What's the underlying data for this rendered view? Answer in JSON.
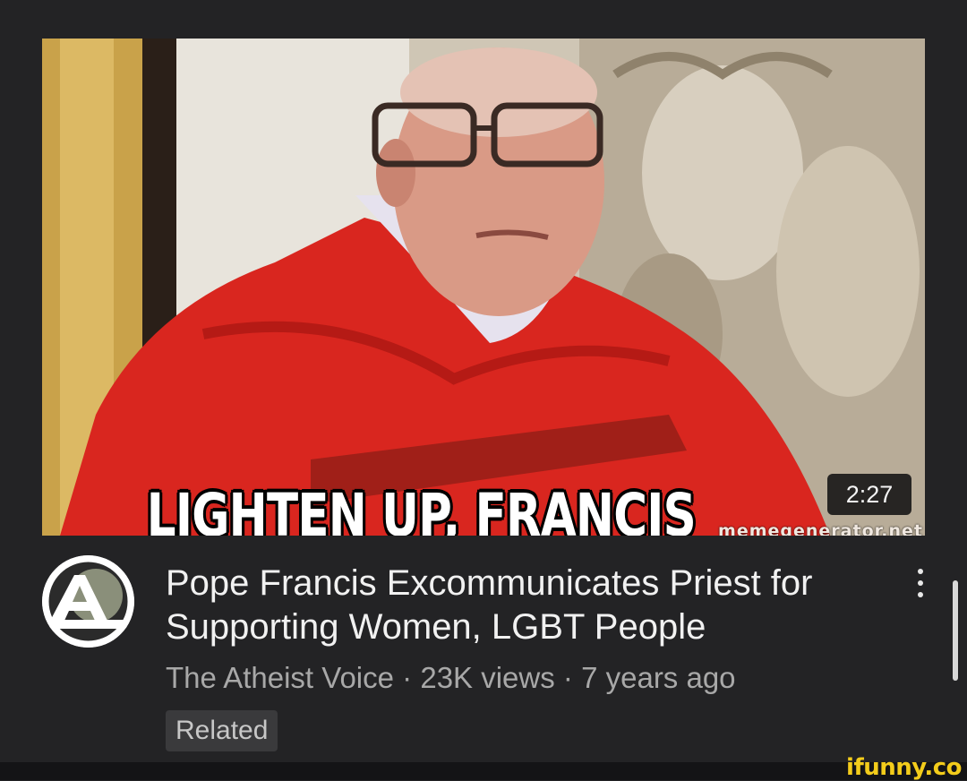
{
  "video": {
    "thumbnail_caption": "LIGHTEN UP, FRANCIS",
    "thumbnail_watermark": "memegenerator.net",
    "duration": "2:27",
    "title": "Pope Francis Excommunicates Priest for Supporting Women, LGBT People",
    "channel": "The Atheist Voice",
    "views": "23K views",
    "age": "7 years ago",
    "separator": "·",
    "badge": "Related"
  },
  "avatar_letter": "A",
  "site_watermark": "ifunny.co",
  "colors": {
    "background": "#232325",
    "title_text": "#f1f1f1",
    "meta_text": "#a8a8a8",
    "badge_bg": "#3a3a3c",
    "robe_red": "#d9261f",
    "ifunny_yellow": "#f3cc1b"
  },
  "icons": {
    "menu": "more-vert-icon"
  }
}
